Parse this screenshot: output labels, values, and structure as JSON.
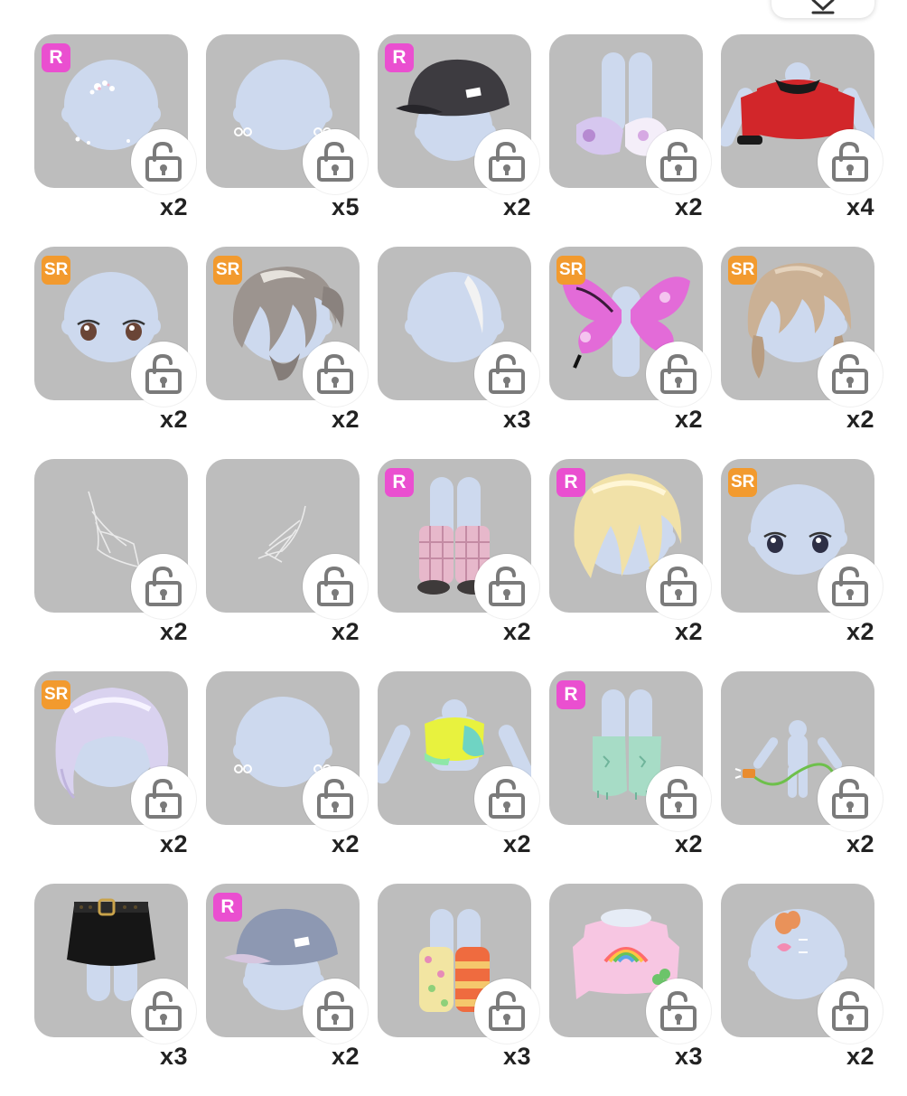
{
  "inventory": {
    "items": [
      {
        "name": "head-sparkle-accessory",
        "badge": "R",
        "count": "x2",
        "art": "head-sparkle"
      },
      {
        "name": "ear-studs",
        "badge": "",
        "count": "x5",
        "art": "head-earrings"
      },
      {
        "name": "black-cap",
        "badge": "R",
        "count": "x2",
        "art": "cap-black"
      },
      {
        "name": "pastel-slides",
        "badge": "",
        "count": "x2",
        "art": "slides"
      },
      {
        "name": "red-cropped-jacket",
        "badge": "",
        "count": "x4",
        "art": "red-top"
      },
      {
        "name": "brown-eyes",
        "badge": "SR",
        "count": "x2",
        "art": "eyes-brown"
      },
      {
        "name": "silver-ponytail-hair",
        "badge": "SR",
        "count": "x2",
        "art": "hair-silver"
      },
      {
        "name": "white-streak-hair",
        "badge": "",
        "count": "x3",
        "art": "head-streak"
      },
      {
        "name": "butterfly-wings",
        "badge": "SR",
        "count": "x2",
        "art": "wings"
      },
      {
        "name": "blonde-braid-hair",
        "badge": "SR",
        "count": "x2",
        "art": "hair-braid"
      },
      {
        "name": "web-tattoo-left",
        "badge": "",
        "count": "x2",
        "art": "web-left"
      },
      {
        "name": "web-tattoo-right",
        "badge": "",
        "count": "x2",
        "art": "web-right"
      },
      {
        "name": "plaid-leg-warmers",
        "badge": "R",
        "count": "x2",
        "art": "legwarmers"
      },
      {
        "name": "blonde-short-hair",
        "badge": "R",
        "count": "x2",
        "art": "hair-blonde"
      },
      {
        "name": "dark-eyes",
        "badge": "SR",
        "count": "x2",
        "art": "eyes-dark"
      },
      {
        "name": "lavender-bob-hair",
        "badge": "SR",
        "count": "x2",
        "art": "hair-lavender"
      },
      {
        "name": "small-earrings",
        "badge": "",
        "count": "x2",
        "art": "head-earrings"
      },
      {
        "name": "neon-crop-top",
        "badge": "",
        "count": "x2",
        "art": "neon-top"
      },
      {
        "name": "mint-socks",
        "badge": "R",
        "count": "x2",
        "art": "mint-socks"
      },
      {
        "name": "charger-cable-accessory",
        "badge": "",
        "count": "x2",
        "art": "cable"
      },
      {
        "name": "black-mini-skirt",
        "badge": "",
        "count": "x3",
        "art": "skirt"
      },
      {
        "name": "blue-cap",
        "badge": "R",
        "count": "x2",
        "art": "cap-blue"
      },
      {
        "name": "polka-stripe-socks",
        "badge": "",
        "count": "x3",
        "art": "polka-socks"
      },
      {
        "name": "rainbow-sweater",
        "badge": "",
        "count": "x3",
        "art": "rainbow-top"
      },
      {
        "name": "heart-hairclips",
        "badge": "",
        "count": "x2",
        "art": "hairclips"
      }
    ]
  },
  "colors": {
    "card_bg": "#bdbdbd",
    "badge_r": "#ea4fd0",
    "badge_sr": "#f29a2e",
    "mannequin": "#cdd9ee"
  }
}
